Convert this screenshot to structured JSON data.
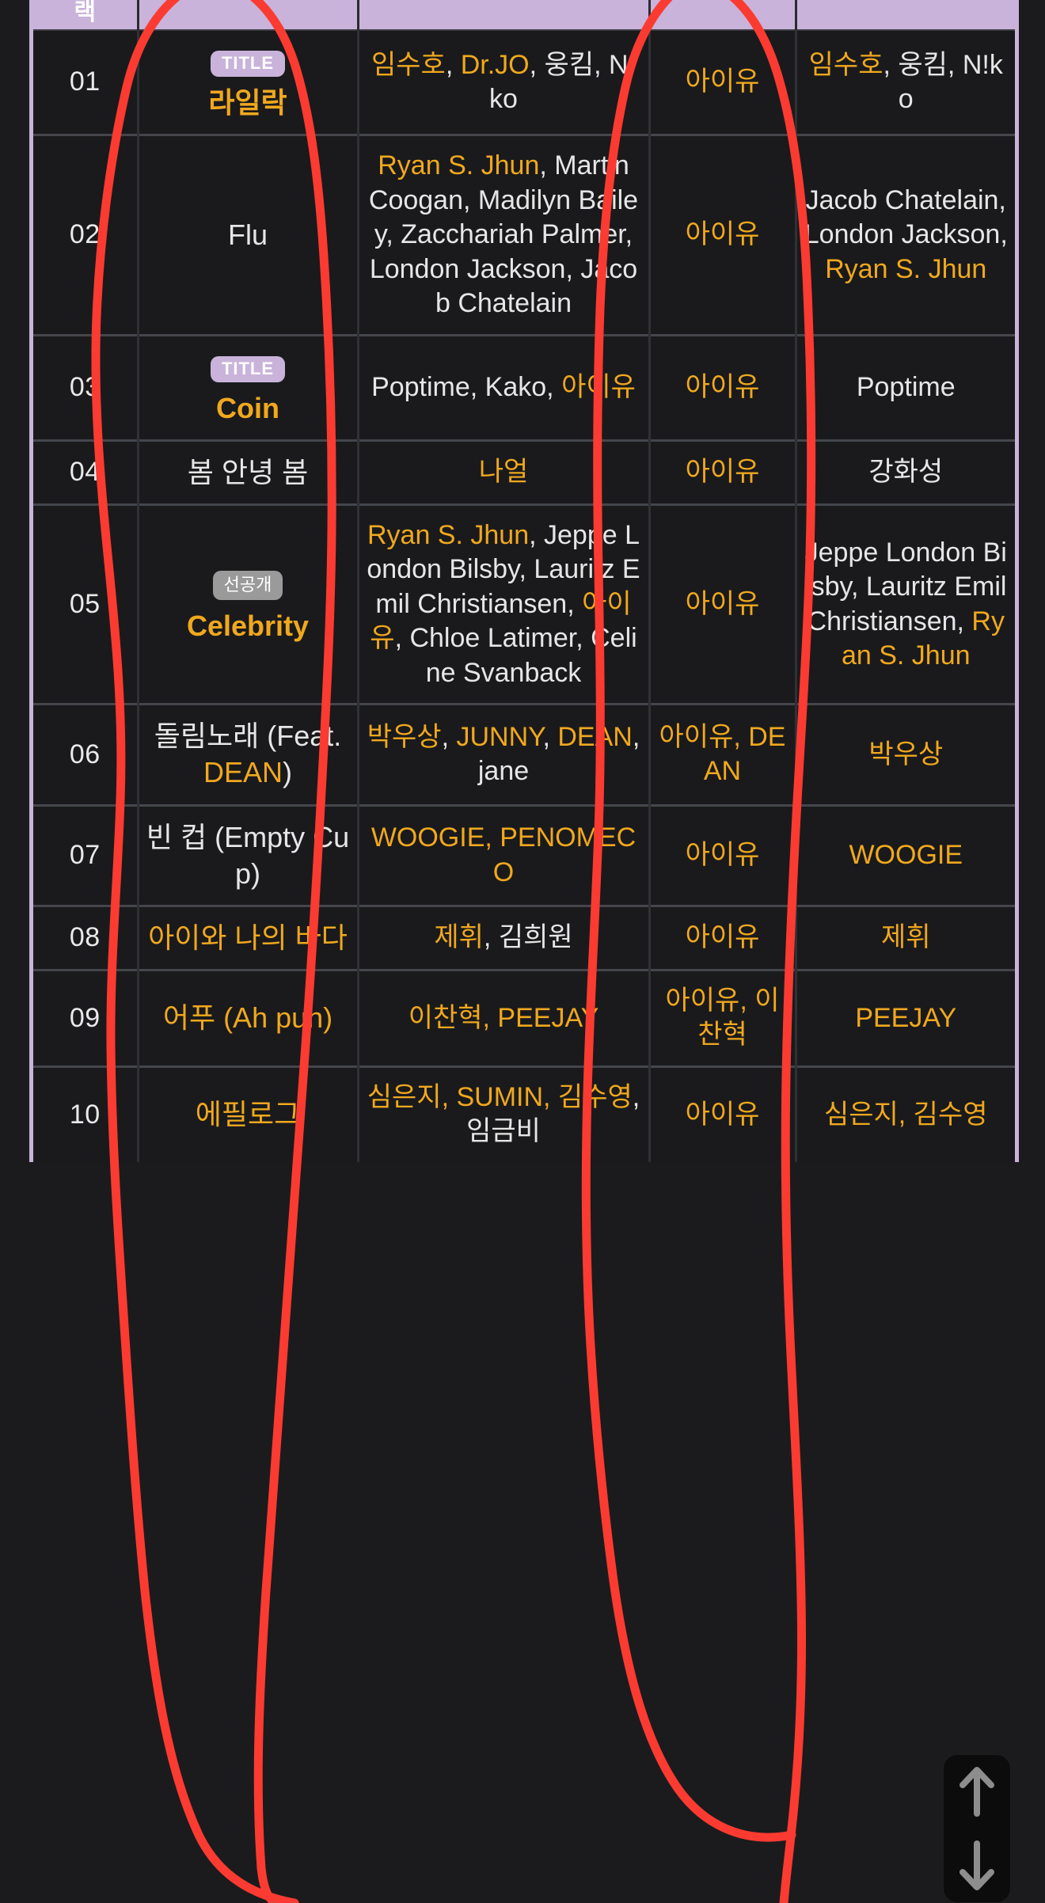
{
  "page": {
    "background": "#1b1b1d",
    "accent_highlight": "#f0a81e",
    "header_bg": "#c9b3da",
    "annotation_color": "#fb3b31"
  },
  "table": {
    "columns": [
      {
        "key": "no",
        "label": "랙"
      },
      {
        "key": "title",
        "label": ""
      },
      {
        "key": "writer",
        "label": ""
      },
      {
        "key": "vocal",
        "label": ""
      },
      {
        "key": "arr",
        "label": ""
      }
    ],
    "rows": [
      {
        "no": "01",
        "badge": "TITLE",
        "badge_type": "title",
        "title": "라일락",
        "title_highlight": true,
        "writer_parts": [
          {
            "t": "임수호",
            "h": true
          },
          {
            "t": ", ",
            "h": false
          },
          {
            "t": "Dr.JO",
            "h": true
          },
          {
            "t": ", 웅킴, N!ko",
            "h": false
          }
        ],
        "vocal_parts": [
          {
            "t": "아이유",
            "h": true
          }
        ],
        "arr_parts": [
          {
            "t": "임수호",
            "h": true
          },
          {
            "t": ", 웅킴, N!ko",
            "h": false
          }
        ]
      },
      {
        "no": "02",
        "badge": null,
        "badge_type": null,
        "title": "Flu",
        "title_highlight": false,
        "writer_parts": [
          {
            "t": "Ryan S. Jhun",
            "h": true
          },
          {
            "t": ", Martin Coogan, Madilyn Bailey, Zacchariah Palmer, London Jackson, Jacob Chatelain",
            "h": false
          }
        ],
        "vocal_parts": [
          {
            "t": "아이유",
            "h": true
          }
        ],
        "arr_parts": [
          {
            "t": "Jacob Chatelain, London Jackson, ",
            "h": false
          },
          {
            "t": "Ryan S. Jhun",
            "h": true
          }
        ]
      },
      {
        "no": "03",
        "badge": "TITLE",
        "badge_type": "title",
        "title": "Coin",
        "title_highlight": true,
        "writer_parts": [
          {
            "t": "Poptime, Kako, ",
            "h": false
          },
          {
            "t": "아이유",
            "h": true
          }
        ],
        "vocal_parts": [
          {
            "t": "아이유",
            "h": true
          }
        ],
        "arr_parts": [
          {
            "t": "Poptime",
            "h": false
          }
        ]
      },
      {
        "no": "04",
        "badge": null,
        "badge_type": null,
        "title": "봄 안녕 봄",
        "title_highlight": false,
        "writer_parts": [
          {
            "t": "나얼",
            "h": true
          }
        ],
        "vocal_parts": [
          {
            "t": "아이유",
            "h": true
          }
        ],
        "arr_parts": [
          {
            "t": "강화성",
            "h": false
          }
        ]
      },
      {
        "no": "05",
        "badge": "선공개",
        "badge_type": "pre",
        "title": "Celebrity",
        "title_highlight": true,
        "writer_parts": [
          {
            "t": "Ryan S. Jhun",
            "h": true
          },
          {
            "t": ", Jeppe London Bilsby, Lauritz Emil Christiansen, ",
            "h": false
          },
          {
            "t": "아이유",
            "h": true
          },
          {
            "t": ", Chloe Latimer, Celine Svanback",
            "h": false
          }
        ],
        "vocal_parts": [
          {
            "t": "아이유",
            "h": true
          }
        ],
        "arr_parts": [
          {
            "t": "Jeppe London Bilsby, Lauritz Emil Christiansen, ",
            "h": false
          },
          {
            "t": "Ryan S. Jhun",
            "h": true
          }
        ]
      },
      {
        "no": "06",
        "badge": null,
        "badge_type": null,
        "title_parts": [
          {
            "t": "돌림노래 (Feat. ",
            "h": false
          },
          {
            "t": "DEAN",
            "h": true
          },
          {
            "t": ")",
            "h": false
          }
        ],
        "writer_parts": [
          {
            "t": "박우상",
            "h": true
          },
          {
            "t": ", ",
            "h": false
          },
          {
            "t": "JUNNY",
            "h": true
          },
          {
            "t": ", ",
            "h": false
          },
          {
            "t": "DEAN",
            "h": true
          },
          {
            "t": ", jane",
            "h": false
          }
        ],
        "vocal_parts": [
          {
            "t": "아이유, DEAN",
            "h": true
          }
        ],
        "arr_parts": [
          {
            "t": "박우상",
            "h": true
          }
        ]
      },
      {
        "no": "07",
        "badge": null,
        "badge_type": null,
        "title": "빈 컵 (Empty Cup)",
        "title_highlight": false,
        "writer_parts": [
          {
            "t": "WOOGIE, PENOMECO",
            "h": true
          }
        ],
        "vocal_parts": [
          {
            "t": "아이유",
            "h": true
          }
        ],
        "arr_parts": [
          {
            "t": "WOOGIE",
            "h": true
          }
        ]
      },
      {
        "no": "08",
        "badge": null,
        "badge_type": null,
        "title": "아이와 나의 바다",
        "title_highlight": true,
        "writer_parts": [
          {
            "t": "제휘",
            "h": true
          },
          {
            "t": ", ",
            "h": false
          },
          {
            "t": "김희원",
            "h": false
          }
        ],
        "vocal_parts": [
          {
            "t": "아이유",
            "h": true
          }
        ],
        "arr_parts": [
          {
            "t": "제휘",
            "h": true
          }
        ]
      },
      {
        "no": "09",
        "badge": null,
        "badge_type": null,
        "title": "어푸 (Ah puh)",
        "title_highlight": true,
        "writer_parts": [
          {
            "t": "이찬혁, PEEJAY",
            "h": true
          }
        ],
        "vocal_parts": [
          {
            "t": "아이유, 이찬혁",
            "h": true
          }
        ],
        "arr_parts": [
          {
            "t": "PEEJAY",
            "h": true
          }
        ]
      },
      {
        "no": "10",
        "badge": null,
        "badge_type": null,
        "title": "에필로그",
        "title_highlight": true,
        "writer_parts": [
          {
            "t": "심은지, SUMIN, 김수영",
            "h": true
          },
          {
            "t": ", 임금비",
            "h": false
          }
        ],
        "vocal_parts": [
          {
            "t": "아이유",
            "h": true
          }
        ],
        "arr_parts": [
          {
            "t": "심은지, 김수영",
            "h": true
          }
        ]
      }
    ]
  },
  "scroll_fab": {
    "up_icon": "arrow-up-icon",
    "down_icon": "arrow-down-icon"
  },
  "annotations": [
    {
      "name": "title-column-circle",
      "shape": "hand-drawn-oval"
    },
    {
      "name": "vocalist-column-circle",
      "shape": "hand-drawn-oval"
    }
  ]
}
